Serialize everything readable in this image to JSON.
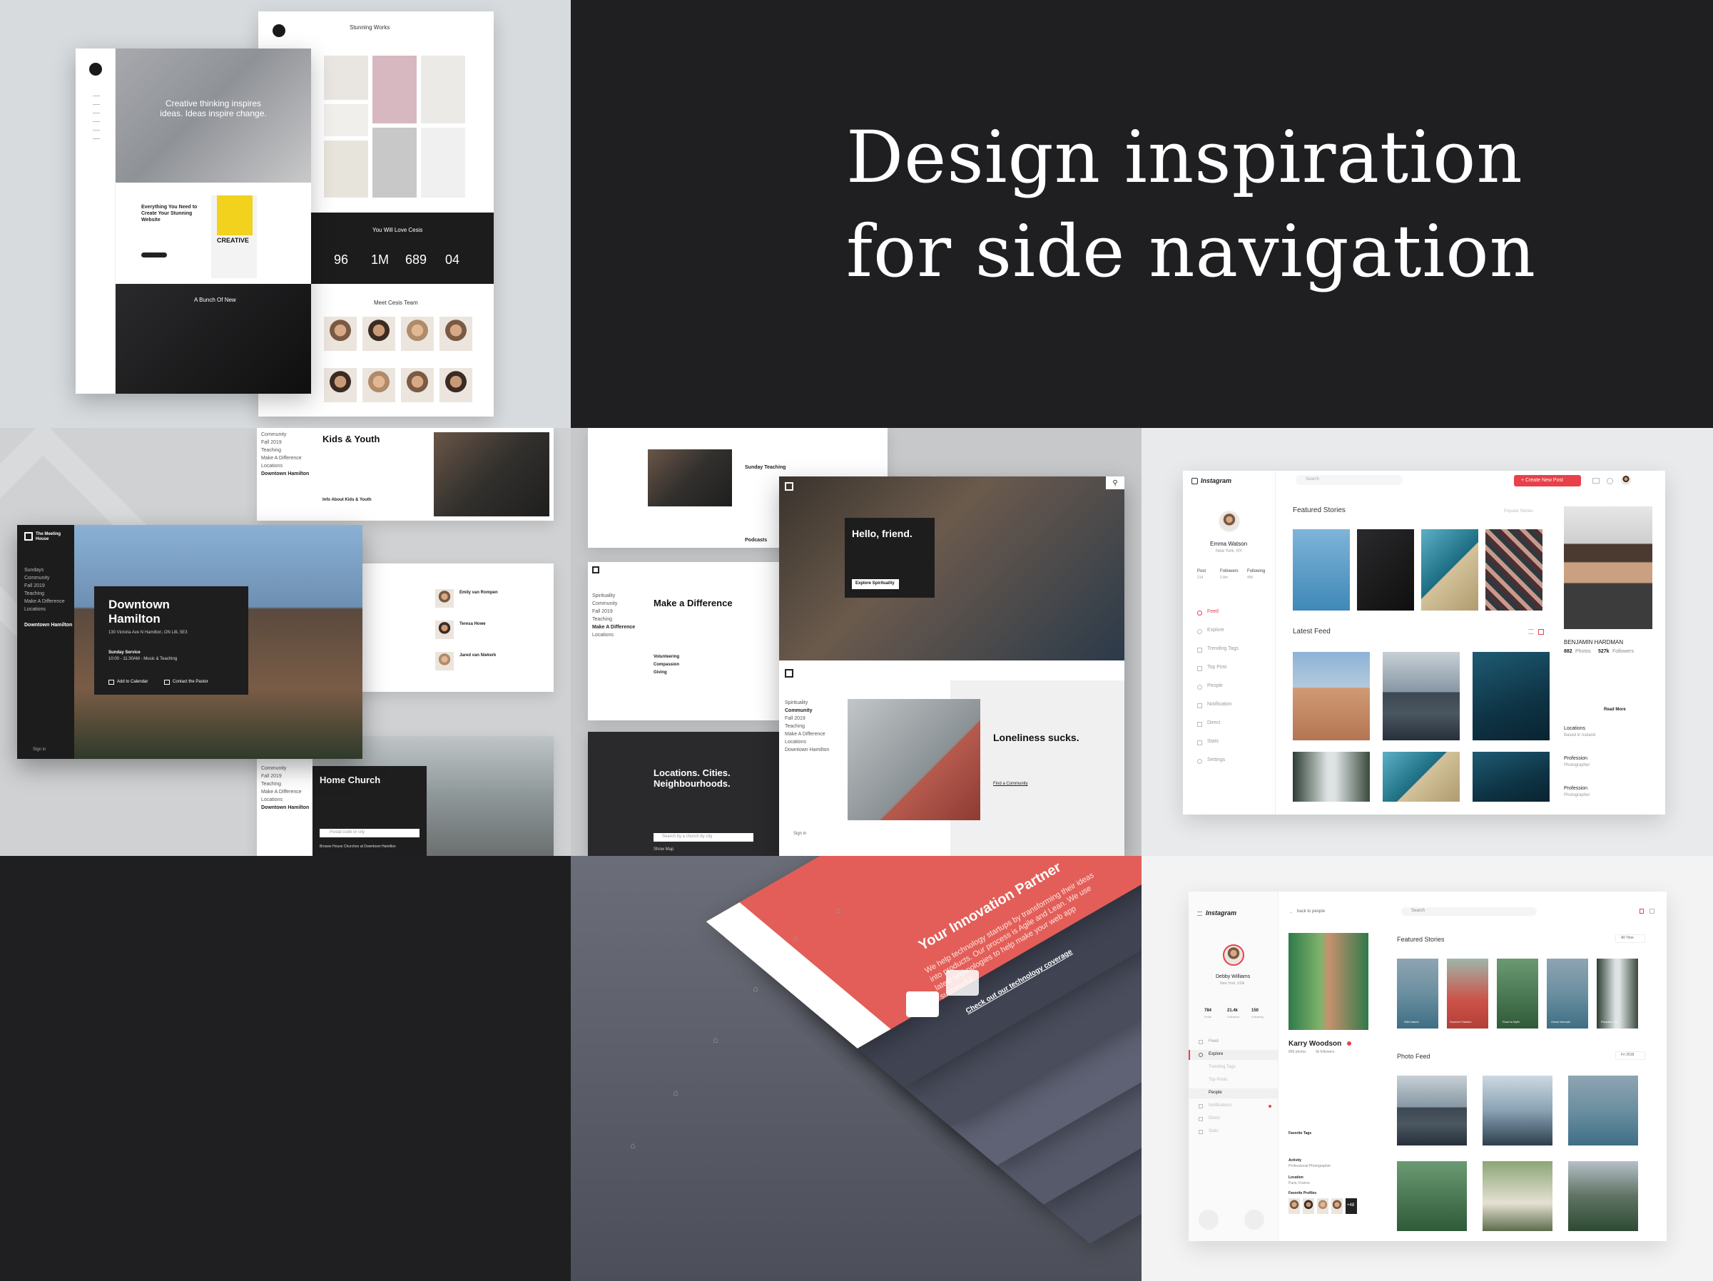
{
  "hero": {
    "title_line1": "Design inspiration",
    "title_line2": "for side navigation"
  },
  "panel_cesis": {
    "header_title": "Stunning Works",
    "hero_text": "Creative thinking inspires ideas. Ideas inspire change.",
    "feature_title": "Everything You Need to Create Your Stunning Website",
    "feature_badge": "CREATIVE",
    "stats_title": "You Will Love Cesis",
    "stats": [
      "96",
      "1M",
      "689",
      "04"
    ],
    "quote_title": "A Bunch Of New",
    "team_title": "Meet Cesis Team"
  },
  "panel_church": {
    "brand": "The Meeting House",
    "nav_items": [
      "Sundays",
      "Community",
      "Fall 2019",
      "Teaching",
      "Make A Difference",
      "Locations",
      "Downtown Hamilton"
    ],
    "side_nav": [
      "Community",
      "Fall 2019",
      "Teaching",
      "Make A Difference",
      "Locations",
      "Downtown Hamilton"
    ],
    "card_title": "Downtown Hamilton",
    "card_address": "130 Victoria Ave N Hamilton, ON L8L 5E3",
    "service_title": "Sunday Service",
    "service_time": "10:00 - 11:30AM - Music & Teaching",
    "add_calendar": "Add to Calendar",
    "contact_pastor": "Contact the Pastor",
    "kids_title": "Kids & Youth",
    "kids_link": "Info About Kids & Youth",
    "home_church_title": "Home Church",
    "search_placeholder": "Postal code or city",
    "browse_link": "Browse House Churches at Downtown Hamilton",
    "signin": "Sign in",
    "contacts": [
      "Emily van Rompen",
      "Teresa Howe",
      "Jared van Niekerk"
    ]
  },
  "panel_meeting": {
    "hello_title": "Hello, friend.",
    "hello_btn": "Explore Spirituality",
    "sunday_teaching": "Sunday Teaching",
    "podcasts": "Podcasts",
    "difference_title": "Make a Difference",
    "difference_links": [
      "Volunteering",
      "Compassion",
      "Giving"
    ],
    "locations_title": "Locations. Cities. Neighbourhoods.",
    "locations_placeholder": "Search by a church by city",
    "show_map": "Show Map",
    "loneliness_title": "Loneliness sucks.",
    "loneliness_link": "Find a Community",
    "nav_items": [
      "Spirituality",
      "Community",
      "Fall 2019",
      "Teaching",
      "Make A Difference",
      "Locations",
      "Downtown Hamilton"
    ],
    "signin": "Sign in"
  },
  "panel_instagram1": {
    "logo": "Instagram",
    "search_placeholder": "Search",
    "new_post": "+ Create New Post",
    "profile_name": "Emma Watson",
    "profile_location": "New York, NY",
    "profile_stats": [
      {
        "label": "Post",
        "value": "214"
      },
      {
        "label": "Followers",
        "value": "2.8m"
      },
      {
        "label": "Following",
        "value": "456"
      }
    ],
    "nav": [
      "Feed",
      "Explore",
      "Trending Tags",
      "Top Post",
      "People",
      "Notification",
      "Direct",
      "Stats",
      "Settings"
    ],
    "featured_title": "Featured Stories",
    "popular_stories": "Popular Stories",
    "latest_title": "Latest Feed",
    "side_name": "BENJAMIN HARDMAN",
    "side_photos": "882",
    "side_photos_label": "Photos",
    "side_followers": "527k",
    "side_followers_label": "Followers",
    "side_read_more": "Read More",
    "side_locations": "Locations",
    "side_location_value": "Based in Iceland",
    "side_profession": "Profession",
    "side_profession_value": "Photographer",
    "side_profession2": "Profession",
    "side_profession2_value": "Photographer"
  },
  "panel_innovation": {
    "title": "Your Innovation Partner",
    "body": "We help technology startups by transforming their ideas into products. Our process is Agile and Lean. We use latest technologies to help make your web app successful.",
    "link": "Check out our technology coverage"
  },
  "panel_instagram2": {
    "logo": "Instagram",
    "back": "back to people",
    "search_placeholder": "Search",
    "profile_name": "Debby Williams",
    "profile_location": "New York, USA",
    "profile_stats": [
      {
        "label": "Posts",
        "value": "784"
      },
      {
        "label": "Followers",
        "value": "21.4k"
      },
      {
        "label": "Following",
        "value": "150"
      }
    ],
    "nav": [
      "Feed",
      "Explore",
      "Trending Tags",
      "Top Posts",
      "People",
      "Notifications",
      "Direct",
      "Stats"
    ],
    "user_name": "Karry Woodson",
    "user_photos": "899 photos",
    "user_followers": "9k followers",
    "favorite_tags_label": "Favorite Tags",
    "activity_label": "Activity",
    "activity_value": "Professional Photographer",
    "location_label": "Location",
    "location_value": "Paris, France",
    "favorite_profiles_label": "Favorite Profiles",
    "favorite_more": "+48",
    "featured_title": "Featured Stories",
    "featured_filter": "All Time",
    "story_labels": [
      "Wild Nature",
      "Summer Fashion",
      "Road to Myth",
      "Urban Nomads",
      "Paradise City"
    ],
    "photo_feed_title": "Photo Feed",
    "photo_feed_filter": "Fri 2018"
  }
}
